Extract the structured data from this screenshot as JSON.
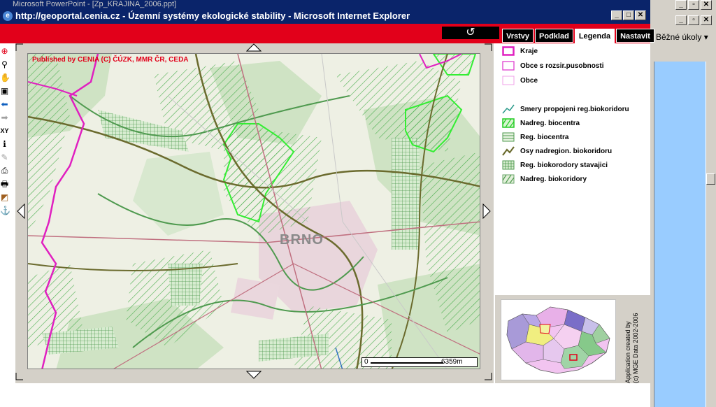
{
  "background_window": {
    "title": "Microsoft PowerPoint - [Zp_KRAJINA_2006.ppt]",
    "task_pane_label": "Běžné úkoly"
  },
  "ie_window": {
    "title": "http://geoportal.cenia.cz - Územní systémy ekologické stability - Microsoft Internet Explorer"
  },
  "toolbar": {
    "refresh_symbol": "↺",
    "tabs": [
      {
        "label": "Vrstvy",
        "active": false
      },
      {
        "label": "Podklad",
        "active": false
      },
      {
        "label": "Legenda",
        "active": true
      },
      {
        "label": "Nastavit",
        "active": false
      }
    ]
  },
  "map": {
    "published_text": "Published by CENIA    (C) ČÚZK, MMR ČR, CEDA",
    "city_label": "BRNO",
    "scale": {
      "start": "0",
      "end": "6359m"
    }
  },
  "legend": {
    "items": [
      {
        "label": "Kraje"
      },
      {
        "label": "Obce s rozsir.pusobnosti"
      },
      {
        "label": "Obce"
      },
      {
        "label": "Smery propojeni reg.biokoridoru"
      },
      {
        "label": "Nadreg. biocentra"
      },
      {
        "label": "Reg. biocentra"
      },
      {
        "label": "Osy nadregion. biokoridoru"
      },
      {
        "label": "Reg. biokorodory stavajici"
      },
      {
        "label": "Nadreg. biokoridory"
      }
    ]
  },
  "credit": {
    "line1": "Application created by",
    "line2": "(c) MGE Data 2002-2006"
  },
  "colors": {
    "accent_red": "#e2001a",
    "title_blue": "#0a246a",
    "boundary_magenta": "#e020c0",
    "biocentre_green": "#33cc33"
  }
}
